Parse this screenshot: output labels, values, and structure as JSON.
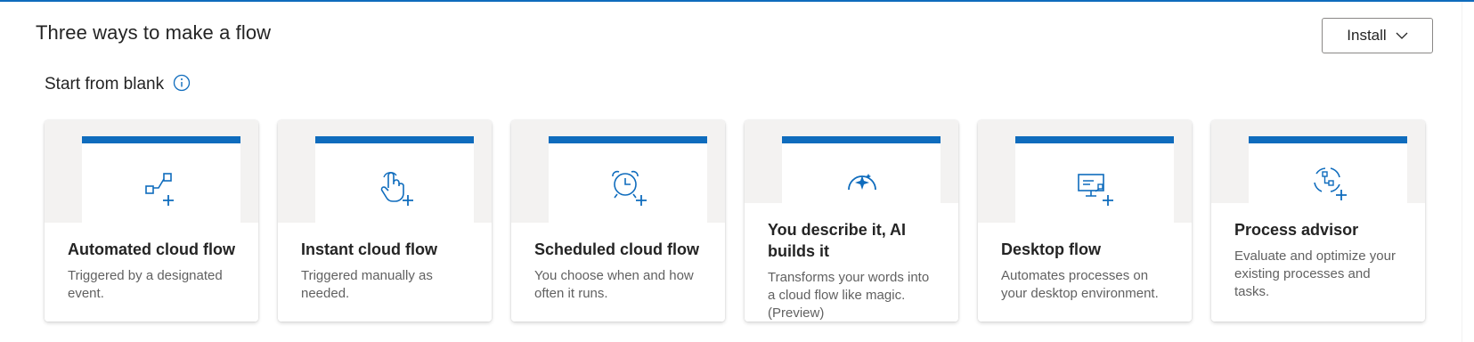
{
  "header": {
    "title": "Three ways to make a flow",
    "install_label": "Install"
  },
  "section": {
    "title": "Start from blank"
  },
  "cards": [
    {
      "name": "Automated cloud flow",
      "description": "Triggered by a designated event.",
      "icon": "automated-flow-icon"
    },
    {
      "name": "Instant cloud flow",
      "description": "Triggered manually as needed.",
      "icon": "touch-hand-icon"
    },
    {
      "name": "Scheduled cloud flow",
      "description": "You choose when and how often it runs.",
      "icon": "alarm-clock-icon"
    },
    {
      "name": "You describe it, AI builds it",
      "description": "Transforms your words into a cloud flow like magic. (Preview)",
      "icon": "ai-sparkle-icon"
    },
    {
      "name": "Desktop flow",
      "description": "Automates processes on your desktop environment.",
      "icon": "desktop-flow-icon"
    },
    {
      "name": "Process advisor",
      "description": "Evaluate and optimize your existing processes and tasks.",
      "icon": "process-advisor-icon"
    }
  ],
  "colors": {
    "accent": "#0f6cbd",
    "card_art_bg": "#f3f2f1"
  }
}
